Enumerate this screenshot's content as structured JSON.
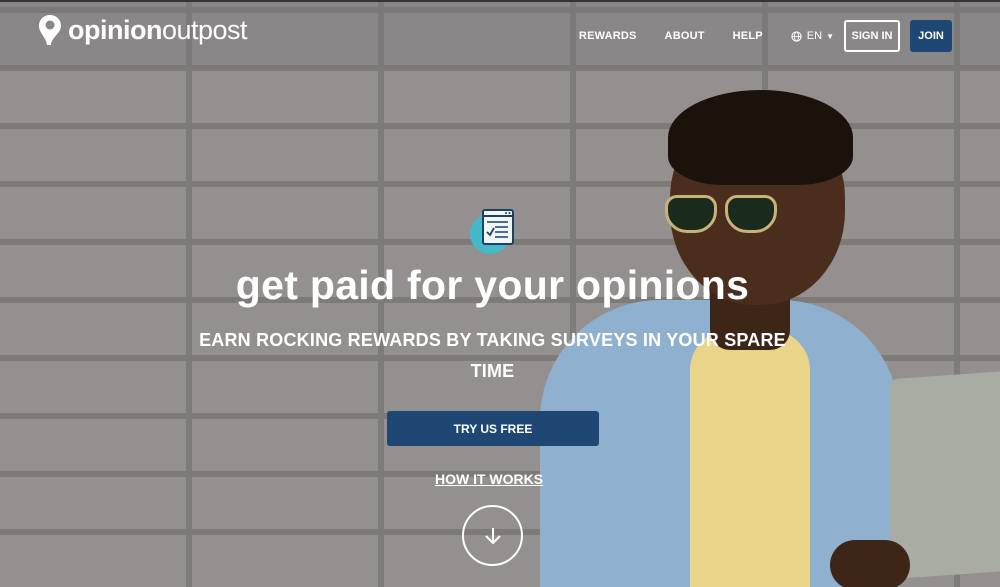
{
  "brand": {
    "logo_bold": "opinion",
    "logo_regular": "outpost"
  },
  "nav": {
    "links": [
      "REWARDS",
      "ABOUT",
      "HELP"
    ],
    "language": "EN",
    "signin_label": "SIGN IN",
    "join_label": "JOIN"
  },
  "hero": {
    "headline": "get paid for your opinions",
    "subheadline": "EARN ROCKING REWARDS BY TAKING SURVEYS IN YOUR SPARE TIME",
    "cta_label": "TRY US FREE",
    "secondary_link": "HOW IT WORKS",
    "scroll_icon": "arrow-down-icon",
    "survey_icon": "survey-form-icon"
  },
  "colors": {
    "primary": "#1e4873",
    "icon_accent": "#45b8c9",
    "text": "#ffffff"
  }
}
